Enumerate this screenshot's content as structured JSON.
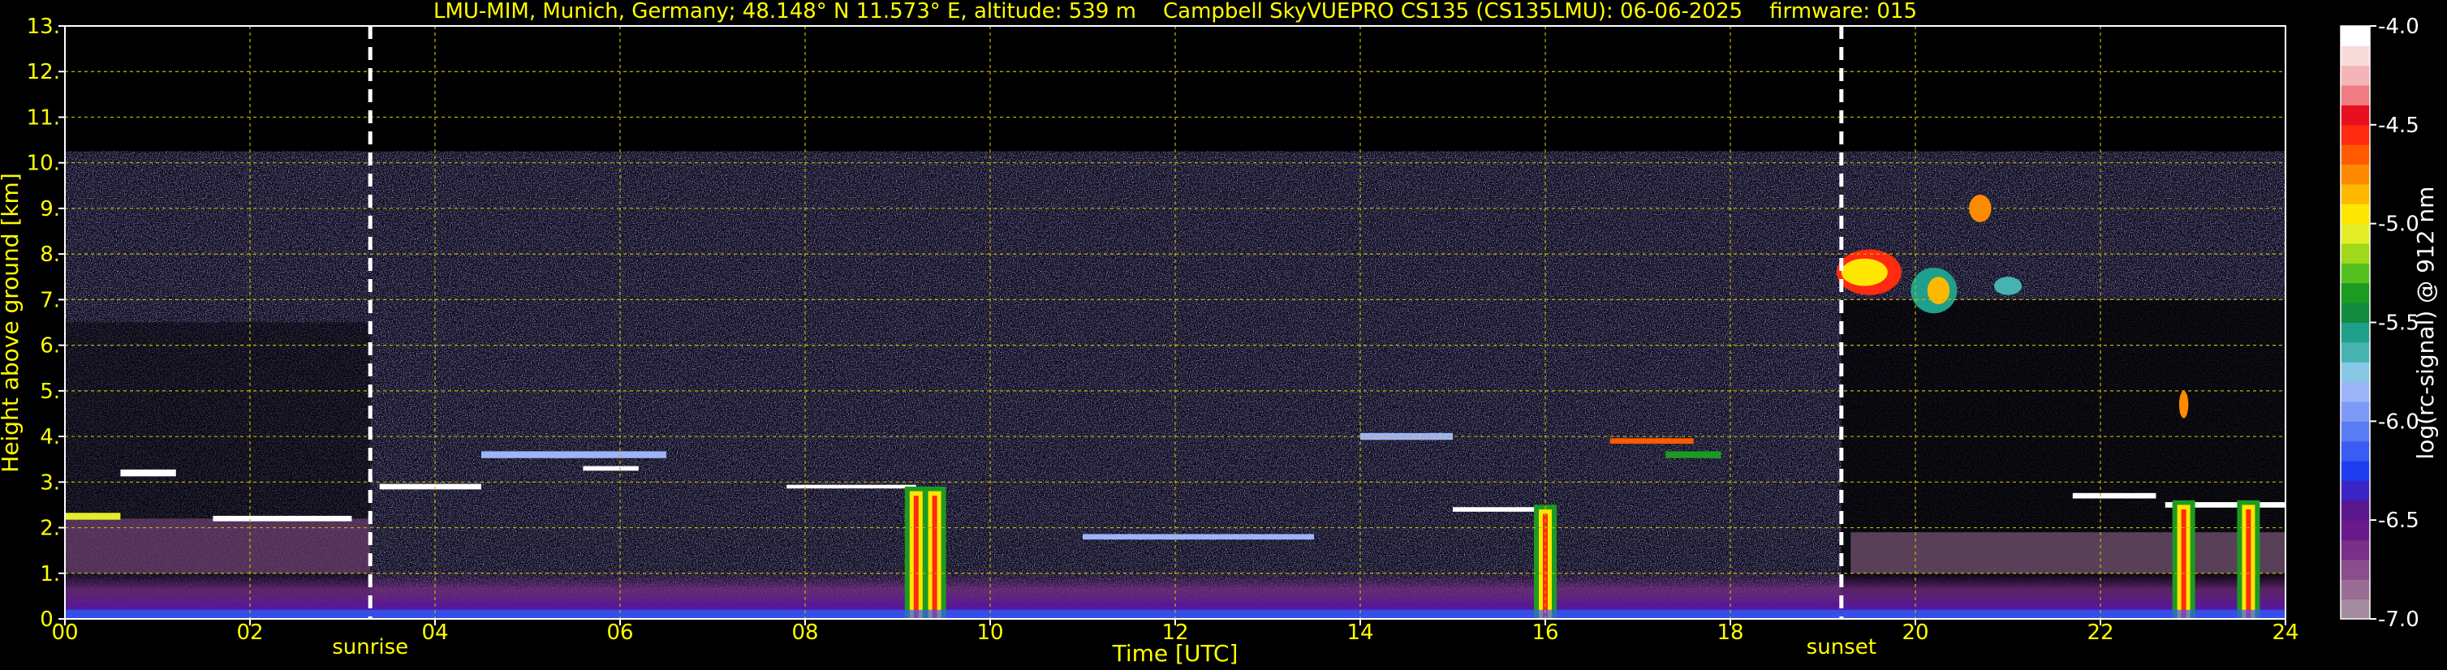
{
  "chart_data": {
    "type": "heatmap",
    "title": "LMU-MIM, Munich, Germany; 48.148° N 11.573° E, altitude: 539 m    Campbell SkyVUEPRO CS135 (CS135LMU): 06-06-2025    firmware: 015",
    "xlabel": "Time [UTC]",
    "ylabel": "Height above ground [km]",
    "xlim": [
      0,
      24
    ],
    "ylim": [
      0,
      13
    ],
    "x_ticks": [
      "00",
      "02",
      "04",
      "06",
      "08",
      "10",
      "12",
      "14",
      "16",
      "18",
      "20",
      "22",
      "24"
    ],
    "y_ticks": [
      "0.",
      "1.",
      "2.",
      "3.",
      "4.",
      "5.",
      "6.",
      "7.",
      "8.",
      "9.",
      "10.",
      "11.",
      "12.",
      "13."
    ],
    "grid": true,
    "colorbar": {
      "label": "log(rc-signal) @ 912 nm",
      "range": [
        -7.0,
        -4.0
      ],
      "ticks": [
        "-4.0",
        "-4.5",
        "-5.0",
        "-5.5",
        "-6.0",
        "-6.5",
        "-7.0"
      ],
      "tick_values": [
        -4.0,
        -4.5,
        -5.0,
        -5.5,
        -6.0,
        -6.5,
        -7.0
      ],
      "colors": [
        "#a58ba0",
        "#9a6d95",
        "#8a4e8c",
        "#7a2f88",
        "#6a1a8a",
        "#5a168f",
        "#3b24c4",
        "#1e3cee",
        "#3a5cf2",
        "#5a7cf4",
        "#7d9af6",
        "#9cb5f8",
        "#88c8e4",
        "#46b3b0",
        "#1fa08c",
        "#138a3c",
        "#1c9a22",
        "#56c020",
        "#a0d81a",
        "#e4ee28",
        "#ffe600",
        "#ffb800",
        "#ff8a00",
        "#ff5a00",
        "#ff2a10",
        "#e81020",
        "#ee7c82",
        "#f4b4b8",
        "#f8dcdc",
        "#ffffff"
      ]
    },
    "markers": [
      {
        "label": "sunrise",
        "x": 3.3
      },
      {
        "label": "sunset",
        "x": 19.2
      }
    ],
    "signal_top_km": 10.25,
    "features": {
      "boundary_layer_aerosol_km": [
        0,
        1.0
      ],
      "low_cloud_layer_km": [
        2.1,
        2.9
      ],
      "mid_cloud_layer_km": [
        2.8,
        4.2
      ],
      "evening_high_cloud_km": [
        6.5,
        9.5
      ],
      "precipitation_streaks_utc": [
        9.2,
        9.4,
        16.0,
        22.9,
        23.6
      ]
    }
  }
}
